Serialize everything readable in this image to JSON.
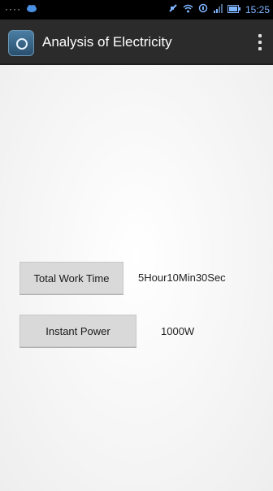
{
  "status_bar": {
    "dots": "····",
    "time": "15:25"
  },
  "app_bar": {
    "title": "Analysis of Electricity"
  },
  "main": {
    "total_work_time_button": "Total  Work Time",
    "total_work_time_value": "5Hour10Min30Sec",
    "instant_power_button": "Instant  Power",
    "instant_power_value": "1000W"
  },
  "colors": {
    "status_bar_bg": "#000000",
    "action_bar_bg": "#2b2b2b",
    "button_bg": "#d9d9d9",
    "time_text": "#7fb4ff"
  }
}
